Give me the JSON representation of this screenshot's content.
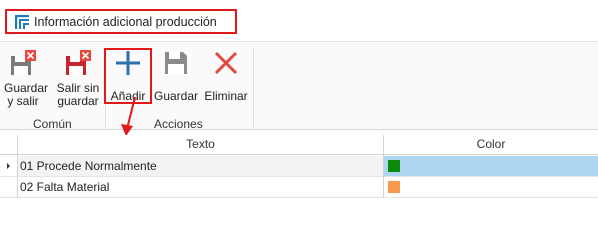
{
  "window": {
    "title": "Información adicional producción",
    "accent": "#e0191c"
  },
  "ribbon": {
    "groups": [
      {
        "label": "Común",
        "buttons": [
          {
            "line1": "Guardar",
            "line2": "y salir",
            "icon": "save-close-icon"
          },
          {
            "line1": "Salir sin",
            "line2": "guardar",
            "icon": "exit-no-save-icon"
          }
        ]
      },
      {
        "label": "Acciones",
        "buttons": [
          {
            "line1": "Añadir",
            "icon": "plus-icon",
            "highlighted": true
          },
          {
            "line1": "Guardar",
            "icon": "save-icon"
          },
          {
            "line1": "Eliminar",
            "icon": "delete-x-icon"
          }
        ]
      }
    ]
  },
  "grid": {
    "columns": [
      "Texto",
      "Color"
    ],
    "rows": [
      {
        "texto": "01 Procede Normalmente",
        "color": "#0a8a0a",
        "selected": true
      },
      {
        "texto": "02 Falta Material",
        "color": "#f79a4d",
        "selected": false
      }
    ]
  }
}
